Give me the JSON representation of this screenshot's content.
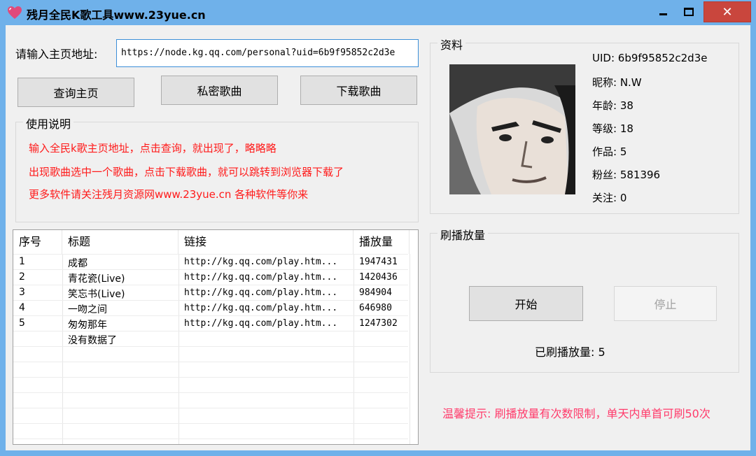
{
  "window": {
    "title": "残月全民K歌工具www.23yue.cn",
    "icon": "heart-icon",
    "close_glyph": "✕"
  },
  "search": {
    "label": "请输入主页地址:",
    "value": "https://node.kg.qq.com/personal?uid=6b9f95852c2d3e"
  },
  "buttons": {
    "query": "查询主页",
    "private": "私密歌曲",
    "download": "下载歌曲",
    "start": "开始",
    "stop": "停止"
  },
  "instructions": {
    "title": "使用说明",
    "lines": [
      "输入全民k歌主页地址，点击查询，就出现了，略略略",
      "出现歌曲选中一个歌曲，点击下载歌曲，就可以跳转到浏览器下载了",
      "更多软件请关注残月资源网www.23yue.cn 各种软件等你来"
    ]
  },
  "table": {
    "headers": [
      "序号",
      "标题",
      "链接",
      "播放量"
    ],
    "rows": [
      {
        "idx": "1",
        "title": "成都",
        "link": "http://kg.qq.com/play.htm...",
        "plays": "1947431"
      },
      {
        "idx": "2",
        "title": "青花瓷(Live)",
        "link": "http://kg.qq.com/play.htm...",
        "plays": "1420436"
      },
      {
        "idx": "3",
        "title": "笑忘书(Live)",
        "link": "http://kg.qq.com/play.htm...",
        "plays": "984904"
      },
      {
        "idx": "4",
        "title": "一吻之间",
        "link": "http://kg.qq.com/play.htm...",
        "plays": "646980"
      },
      {
        "idx": "5",
        "title": "匆匆那年",
        "link": "http://kg.qq.com/play.htm...",
        "plays": "1247302"
      },
      {
        "idx": "",
        "title": "没有数据了",
        "link": "",
        "plays": ""
      }
    ]
  },
  "profile": {
    "title": "资料",
    "uid": "UID: 6b9f95852c2d3e",
    "nickname": "昵称: N.W",
    "age": "年龄: 38",
    "level": "等级: 18",
    "works": "作品: 5",
    "fans": "粉丝: 581396",
    "follow": "关注: 0"
  },
  "boost": {
    "title": "刷播放量",
    "count": "已刷播放量: 5"
  },
  "tip": "温馨提示: 刷播放量有次数限制，单天内单首可刷50次"
}
